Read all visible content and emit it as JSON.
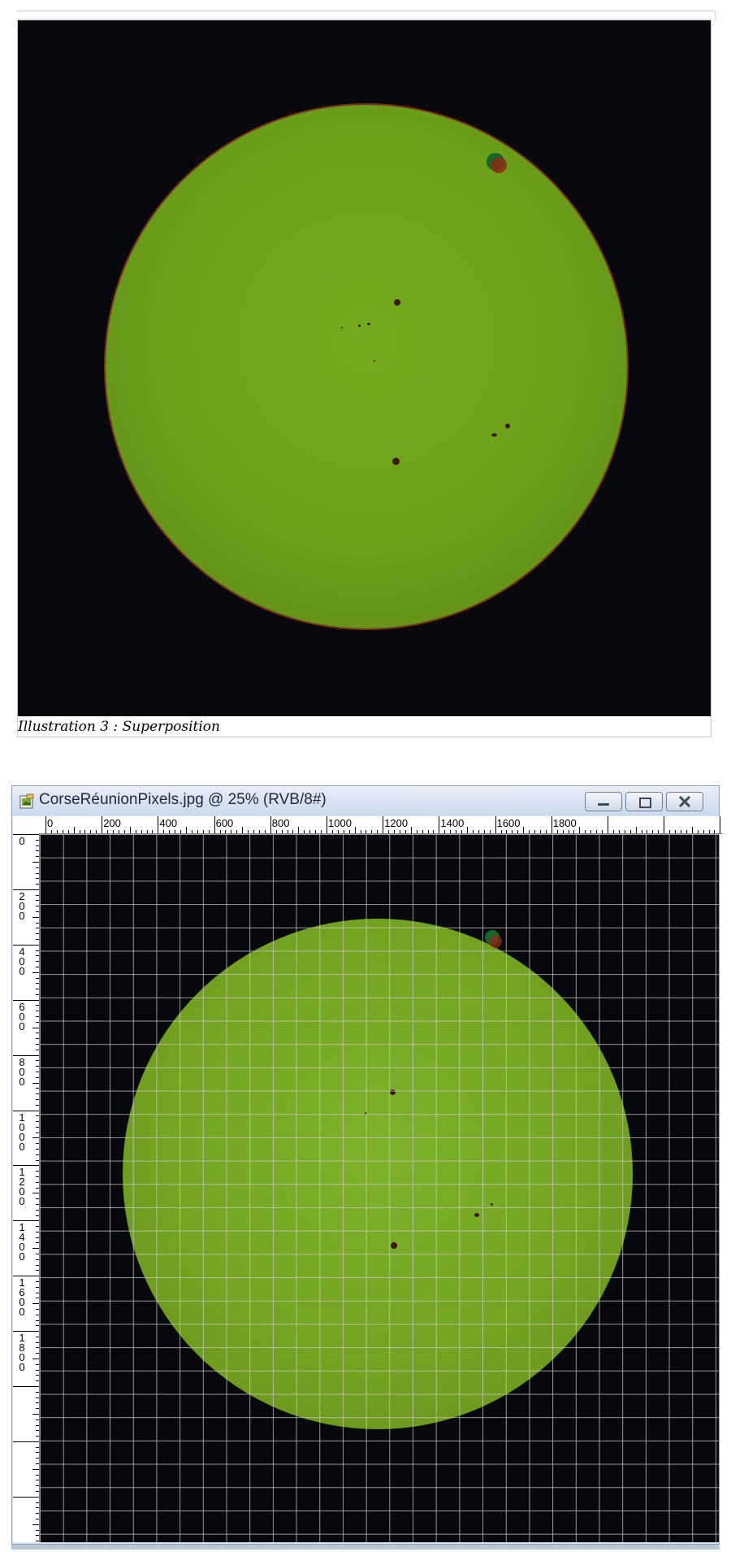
{
  "document": {
    "caption": "Illustration 3 : Superposition"
  },
  "window": {
    "title": "CorseRéunionPixels.jpg @ 25% (RVB/8#)",
    "minimize_icon": "minimize-icon",
    "restore_icon": "restore-icon",
    "close_icon": "close-icon"
  },
  "rulers": {
    "horizontal": [
      "0",
      "200",
      "400",
      "600",
      "800",
      "1000",
      "1200",
      "1400",
      "1600",
      "1800"
    ],
    "vertical": [
      "0",
      "200",
      "400",
      "600",
      "800",
      "1000",
      "1200",
      "1400",
      "1600",
      "1800"
    ]
  },
  "colors": {
    "sun": "#72a31f",
    "sky": "#06080d",
    "grid": "#c8c8c8"
  }
}
